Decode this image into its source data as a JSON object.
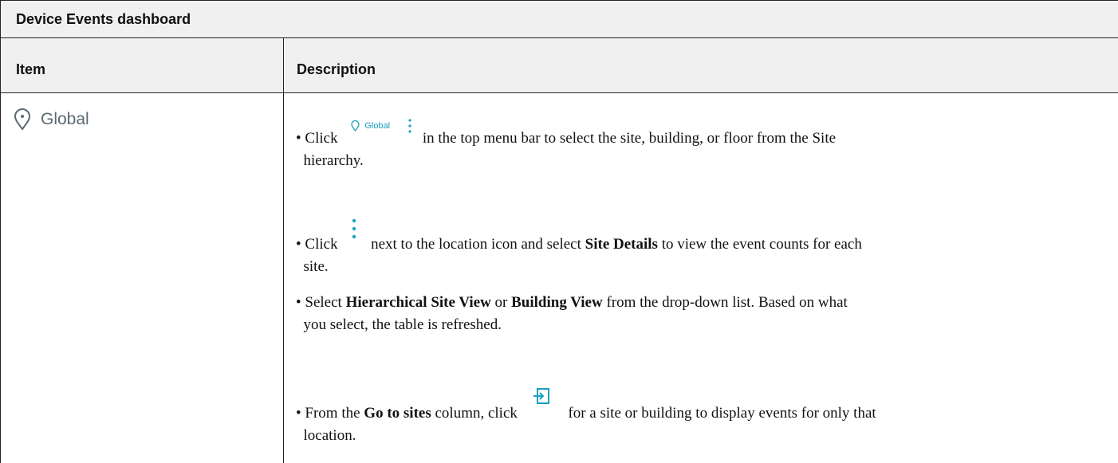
{
  "table": {
    "title": "Device Events dashboard",
    "headers": {
      "item": "Item",
      "description": "Description"
    }
  },
  "item": {
    "label": "Global",
    "icon": "location-pin-icon"
  },
  "chip": {
    "label": "Global"
  },
  "bullets": {
    "b1": {
      "prefix": "• Click",
      "suffix": "in the top menu bar to select the site, building, or floor from the Site",
      "line2": "hierarchy."
    },
    "b2": {
      "prefix": "• Click",
      "mid": "next to the location icon and select",
      "bold": "Site Details",
      "suffix": "to view the event counts for each",
      "line2": "site."
    },
    "b3": {
      "prefix": "• Select",
      "bold1": "Hierarchical Site View",
      "or": "or",
      "bold2": "Building View",
      "suffix": "from the drop-down list. Based on what",
      "line2": "you select, the table is refreshed."
    },
    "b4": {
      "prefix": "• From the",
      "bold": "Go to sites",
      "mid": "column, click",
      "suffix": "for a site or building to display events for only that",
      "line2": "location."
    }
  },
  "colors": {
    "accent": "#19a0c4",
    "header_bg": "#f0f0f0",
    "item_text": "#5a6a72"
  }
}
